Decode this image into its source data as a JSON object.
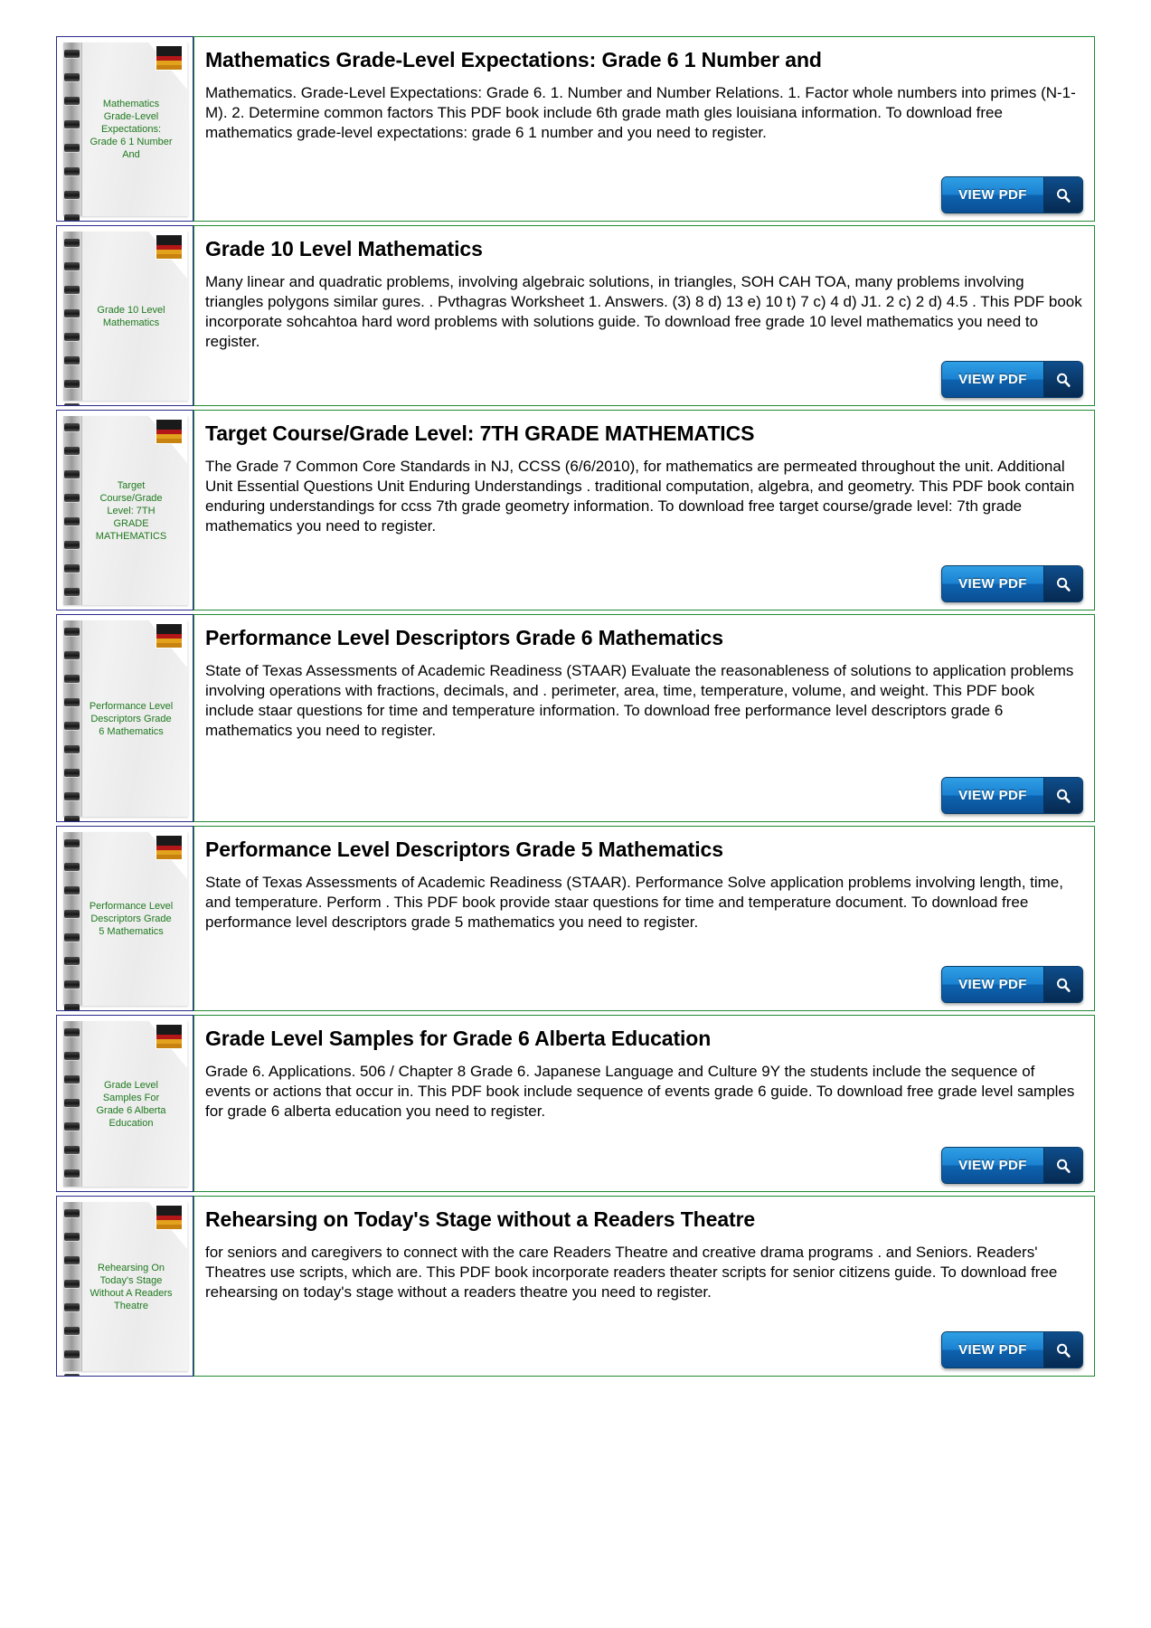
{
  "page": {
    "background_color": "#ffffff",
    "thumb_border_color": "#2a2a8c",
    "card_border_color": "#1f8a32",
    "caption_color": "#1f7a1f",
    "button_accent_color": "#1b82d2"
  },
  "button": {
    "label": "VIEW PDF",
    "icon": "search-icon"
  },
  "results": [
    {
      "thumb_caption": "Mathematics\nGrade-Level\nExpectations:\nGrade 6 1 Number\nAnd",
      "title": "Mathematics Grade-Level Expectations: Grade 6 1 Number and",
      "snippet": "Mathematics. Grade-Level Expectations: Grade 6. 1. Number and Number Relations. 1. Factor whole numbers into primes (N-1-M). 2. Determine common factors  This PDF book include 6th grade math gles louisiana information. To download free mathematics grade-level expectations: grade 6 1 number and you need to register."
    },
    {
      "thumb_caption": "Grade 10 Level\nMathematics",
      "title": "Grade 10 Level Mathematics",
      "snippet": "Many linear and quadratic problems, involving algebraic solutions, in triangles, SOH CAH TOA, many problems involving triangles polygons similar gures. . Pvthagras Worksheet 1. Answers. (3) 8 d) 13 e) 10 t) 7 c) 4 d) J1. 2 c) 2 d) 4.5 . This PDF book incorporate sohcahtoa hard word problems with solutions guide. To download free grade 10 level mathematics you need to register."
    },
    {
      "thumb_caption": "Target\nCourse/Grade\nLevel: 7TH\nGRADE\nMATHEMATICS",
      "title": "Target Course/Grade Level: 7TH GRADE MATHEMATICS",
      "snippet": "The Grade 7 Common Core Standards in NJ, CCSS (6/6/2010), for mathematics are permeated throughout the unit. Additional Unit Essential Questions Unit Enduring Understandings . traditional computation, algebra, and geometry. This PDF book contain enduring understandings for ccss 7th grade geometry information. To download free target course/grade level: 7th grade mathematics you need to register."
    },
    {
      "thumb_caption": "Performance Level\nDescriptors Grade\n6 Mathematics",
      "title": "Performance Level Descriptors Grade 6 Mathematics",
      "snippet": "State of Texas Assessments of Academic Readiness (STAAR) Evaluate the reasonableness of solutions to application problems involving operations with fractions, decimals, and . perimeter, area, time, temperature, volume, and weight. This PDF book include staar questions for time and temperature information. To download free performance level descriptors grade 6 mathematics you need to register."
    },
    {
      "thumb_caption": "Performance Level\nDescriptors Grade\n5 Mathematics",
      "title": "Performance Level Descriptors Grade 5 Mathematics",
      "snippet": "State of Texas Assessments of Academic Readiness (STAAR). Performance Solve application problems involving length, time, and temperature. Perform . This PDF book provide staar questions for time and temperature document. To download free performance level descriptors grade 5 mathematics you need to register."
    },
    {
      "thumb_caption": "Grade Level\nSamples For\nGrade 6 Alberta\nEducation",
      "title": "Grade Level Samples for Grade 6 Alberta Education",
      "snippet": "Grade 6. Applications. 506 / Chapter 8 Grade 6. Japanese Language and Culture 9Y the students include the sequence of events or actions that occur in. This PDF book include sequence of events grade 6 guide. To download free grade level samples for grade 6 alberta education you need to register."
    },
    {
      "thumb_caption": "Rehearsing On\nToday's Stage\nWithout A Readers\nTheatre",
      "title": "Rehearsing on Today's Stage without a Readers Theatre",
      "snippet": "for seniors and caregivers to connect with the care Readers Theatre and creative drama programs . and Seniors. Readers' Theatres use scripts, which are. This PDF book incorporate readers theater scripts for senior citizens guide. To download free rehearsing on today's stage without a readers theatre you need to register."
    }
  ]
}
